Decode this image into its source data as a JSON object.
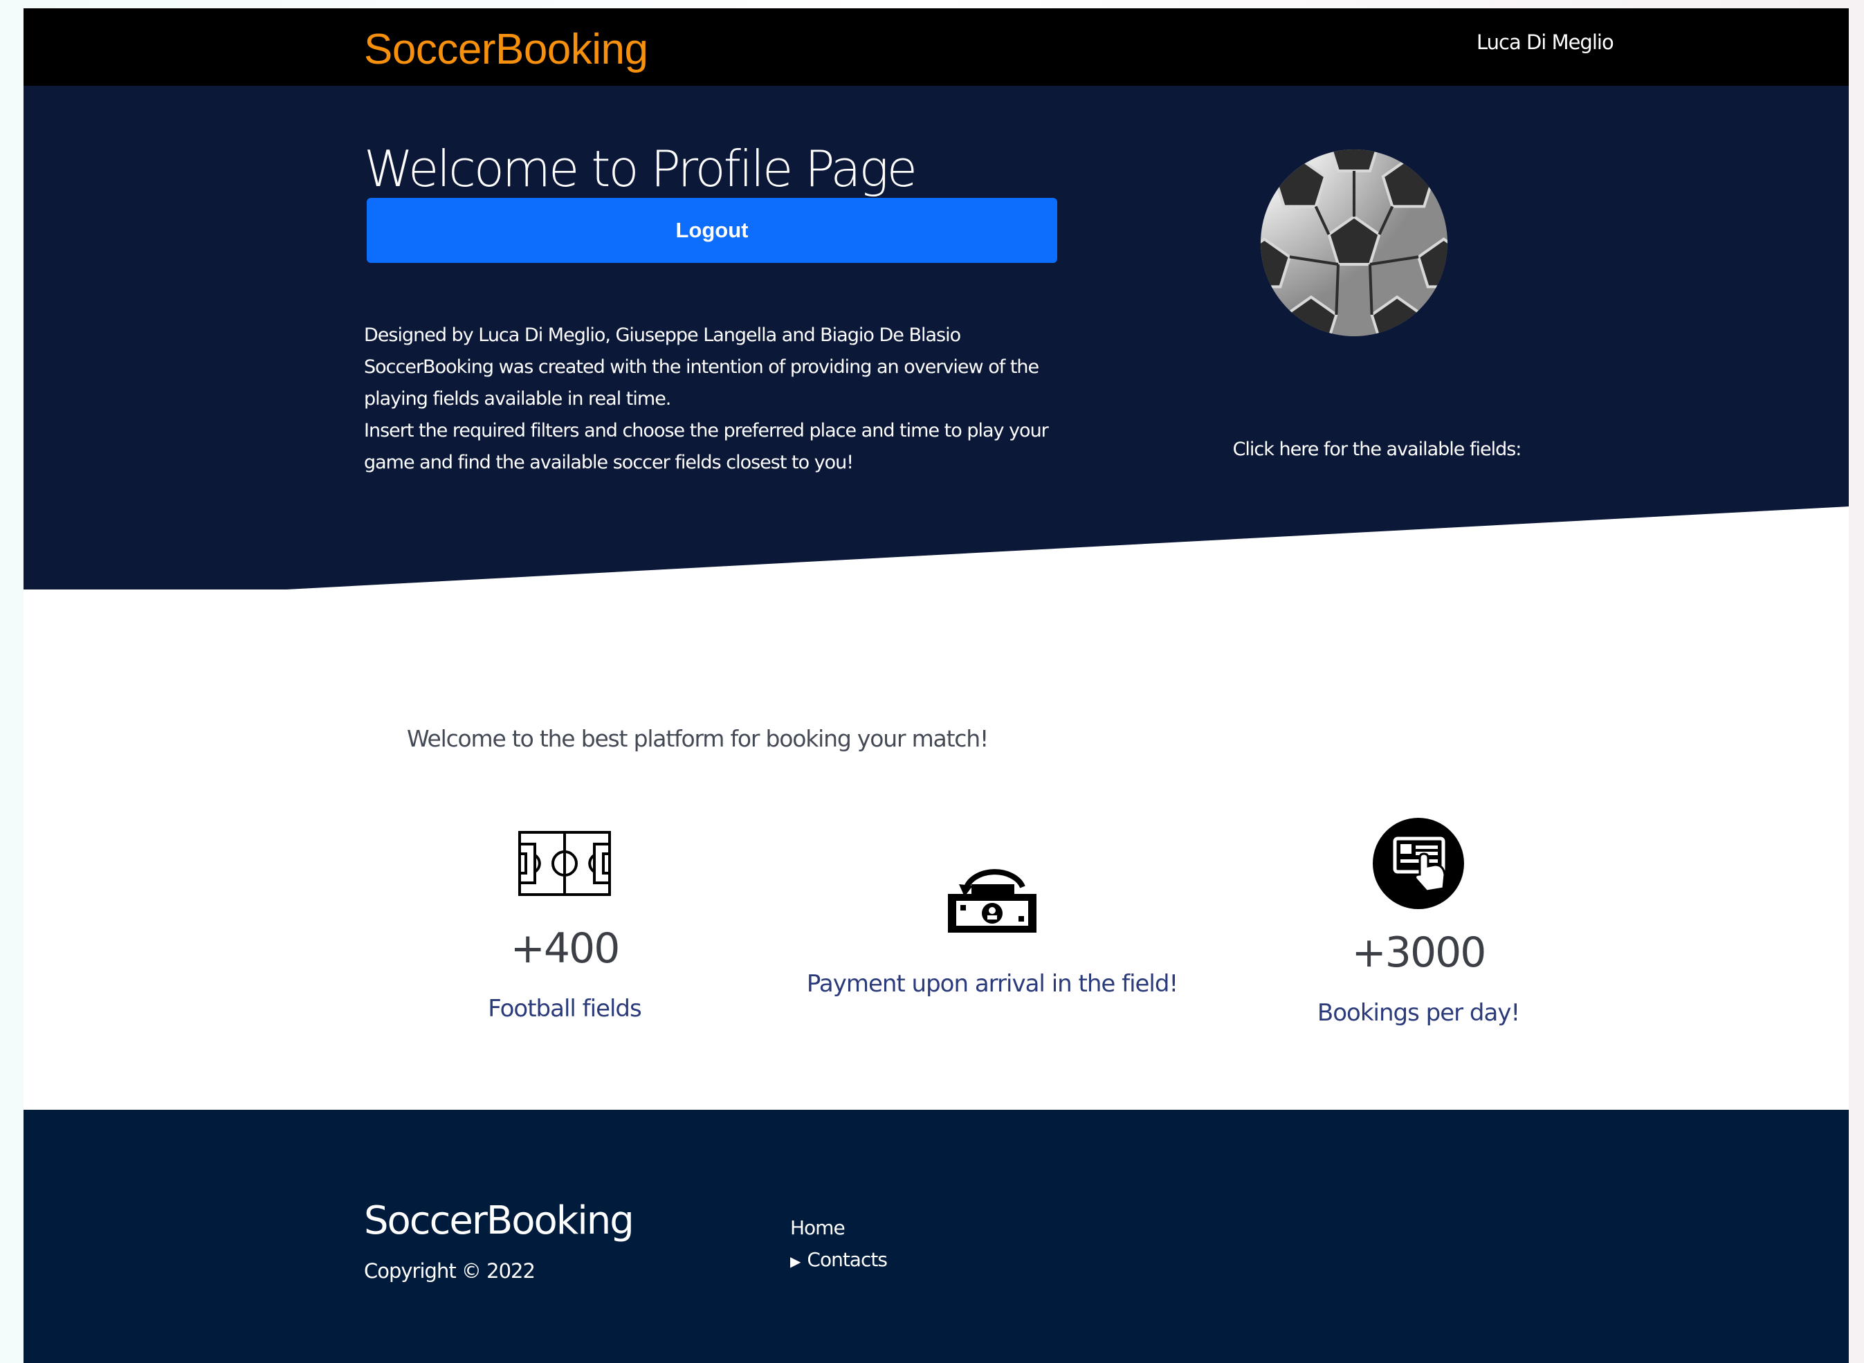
{
  "nav": {
    "brand": "SoccerBooking",
    "user": "Luca Di Meglio"
  },
  "hero": {
    "title": "Welcome to Profile Page",
    "logout_label": "Logout",
    "description_lines": [
      "Designed by Luca Di Meglio, Giuseppe Langella and Biagio De Blasio",
      "SoccerBooking was created with the intention of providing an overview of the",
      "playing fields available in real time.",
      "Insert the required filters and choose the preferred place and time to play your",
      "game and find the available soccer fields closest to you!"
    ],
    "fields_link": "Click here for the available fields:"
  },
  "features": {
    "tagline": "Welcome to the best platform for booking your match!",
    "items": [
      {
        "icon": "soccer-field-icon",
        "stat": "+400",
        "caption": "Football fields"
      },
      {
        "icon": "cash-payment-icon",
        "stat": "",
        "caption": "Payment upon arrival in the field!"
      },
      {
        "icon": "booking-card-icon",
        "stat": "+3000",
        "caption": "Bookings per day!"
      }
    ]
  },
  "footer": {
    "brand": "SoccerBooking",
    "copyright": "Copyright © 2022",
    "links": [
      "Home",
      "Contacts"
    ]
  },
  "colors": {
    "brand": "#f7900c",
    "nav_bg": "#000000",
    "hero_bg": "#0b1838",
    "button": "#0d6efd",
    "caption": "#2a3a7a",
    "footer_bg": "#001b3b"
  }
}
